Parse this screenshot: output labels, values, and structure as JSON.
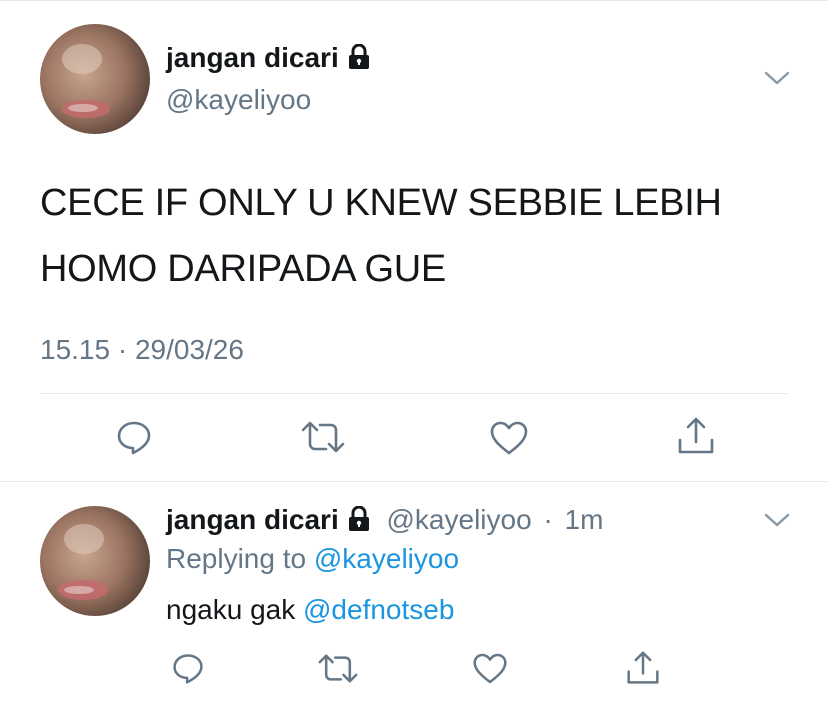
{
  "main_tweet": {
    "author_name": "jangan dicari",
    "author_handle": "@kayeliyoo",
    "text_line1": "CECE IF ONLY U KNEW SEBBIE LEBIH",
    "text_line2": "HOMO DARIPADA GUE",
    "timestamp": "15.15 · 29/03/26",
    "actions": [
      "reply-icon",
      "retweet-icon",
      "like-icon",
      "share-icon"
    ]
  },
  "reply_tweet": {
    "author_name": "jangan dicari",
    "author_handle": "@kayeliyoo",
    "separator": "·",
    "time_ago": "1m",
    "replying_to_label": "Replying to",
    "replying_to_handle": "@kayeliyoo",
    "text_prefix": "ngaku gak",
    "text_mention": "@defnotseb",
    "actions": [
      "reply-icon",
      "retweet-icon",
      "like-icon",
      "share-icon"
    ]
  },
  "colors": {
    "text": "#14171a",
    "secondary": "#657786",
    "link": "#1b95e0",
    "icon": "#657786",
    "divider": "#e1e8ed"
  },
  "icons": {
    "lock": "lock-icon",
    "menu": "chevron-down-icon"
  }
}
